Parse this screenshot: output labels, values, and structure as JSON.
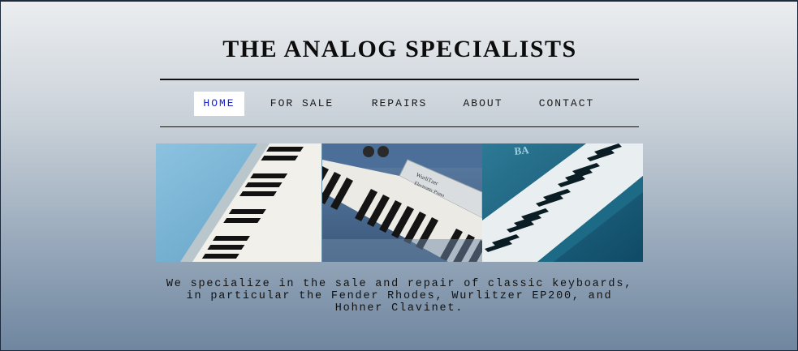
{
  "site": {
    "title": "THE ANALOG SPECIALISTS"
  },
  "nav": {
    "items": [
      {
        "label": "HOME",
        "active": true
      },
      {
        "label": "FOR SALE",
        "active": false
      },
      {
        "label": "REPAIRS",
        "active": false
      },
      {
        "label": "ABOUT",
        "active": false
      },
      {
        "label": "CONTACT",
        "active": false
      }
    ]
  },
  "hero": {
    "photos": [
      {
        "name": "light-blue-piano-keys-photo"
      },
      {
        "name": "wurlitzer-electronic-piano-photo",
        "label_lines": [
          "WurliTzer",
          "Electronic Piano"
        ]
      },
      {
        "name": "teal-grand-piano-photo",
        "brand_fragment": "BA"
      }
    ]
  },
  "intro": {
    "text": "We specialize in the sale and repair of classic keyboards, in particular the Fender Rhodes, Wurlitzer EP200, and Hohner Clavinet."
  },
  "colors": {
    "nav_active_text": "#1a22c8",
    "nav_active_bg": "#ffffff",
    "title_text": "#0c0c0c"
  }
}
